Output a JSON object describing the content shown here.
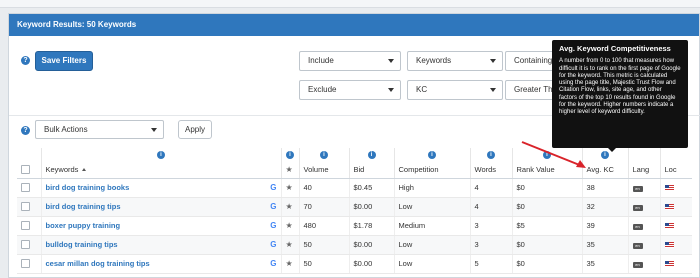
{
  "header": {
    "title": "Keyword Results: 50 Keywords"
  },
  "filters": {
    "save_label": "Save Filters",
    "row1": {
      "mode": "Include",
      "field": "Keywords",
      "operator": "Containing"
    },
    "row2": {
      "mode": "Exclude",
      "field": "KC",
      "operator": "Greater Tha"
    }
  },
  "bulk": {
    "select": "Bulk Actions",
    "apply_label": "Apply"
  },
  "table": {
    "columns": [
      "Keywords",
      "Volume",
      "Bid",
      "Competition",
      "Words",
      "Rank Value",
      "Avg. KC",
      "Lang",
      "Loc"
    ],
    "rows": [
      {
        "keyword": "bird dog training books",
        "volume": "40",
        "bid": "$0.45",
        "competition": "High",
        "words": "4",
        "rank": "$0",
        "kc": "38"
      },
      {
        "keyword": "bird dog training tips",
        "volume": "70",
        "bid": "$0.00",
        "competition": "Low",
        "words": "4",
        "rank": "$0",
        "kc": "32"
      },
      {
        "keyword": "boxer puppy training",
        "volume": "480",
        "bid": "$1.78",
        "competition": "Medium",
        "words": "3",
        "rank": "$5",
        "kc": "39"
      },
      {
        "keyword": "bulldog training tips",
        "volume": "50",
        "bid": "$0.00",
        "competition": "Low",
        "words": "3",
        "rank": "$0",
        "kc": "35"
      },
      {
        "keyword": "cesar millan dog training tips",
        "volume": "50",
        "bid": "$0.00",
        "competition": "Low",
        "words": "5",
        "rank": "$0",
        "kc": "35"
      }
    ]
  },
  "tooltip": {
    "title": "Avg. Keyword Competitiveness",
    "body": "A number from 0 to 100 that measures how difficult it is to rank on the first page of Google for the keyword. This metric is calculated using the page title, Majestic Trust Flow and Citation Flow, links, site age, and other factors of the top 10 results found in Google for the keyword. Higher numbers indicate a higher level of keyword difficulty."
  },
  "colors": {
    "brand": "#2f77bd",
    "annotation_arrow": "#d9232a"
  },
  "icons": {
    "info": "info-icon",
    "help": "question-icon",
    "google": "google-icon",
    "star": "star-icon",
    "sort": "sort-asc-icon",
    "flag": "us-flag-icon",
    "lang": "language-badge"
  }
}
